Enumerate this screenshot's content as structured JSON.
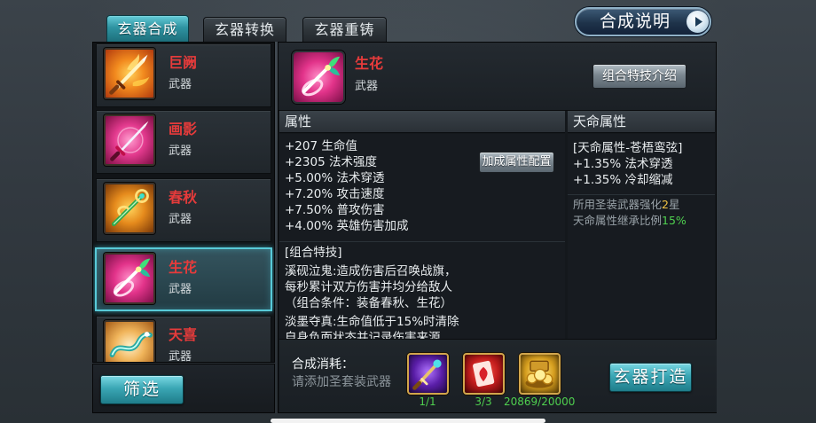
{
  "tabs": [
    {
      "label": "玄器合成",
      "active": true
    },
    {
      "label": "玄器转换",
      "active": false
    },
    {
      "label": "玄器重铸",
      "active": false
    }
  ],
  "help_button": {
    "label": "合成说明",
    "icon": "arrow-right-icon"
  },
  "item_list": [
    {
      "name": "巨阙",
      "type": "武器",
      "icon": "golden-flame-sword-icon",
      "selected": false
    },
    {
      "name": "画影",
      "type": "武器",
      "icon": "pink-sword-icon",
      "selected": false
    },
    {
      "name": "春秋",
      "type": "武器",
      "icon": "jade-staff-icon",
      "selected": false
    },
    {
      "name": "生花",
      "type": "武器",
      "icon": "flower-wand-icon",
      "selected": true
    },
    {
      "name": "天喜",
      "type": "武器",
      "icon": "jade-dragon-icon",
      "selected": false
    }
  ],
  "filter_button": {
    "label": "筛选"
  },
  "detail": {
    "name": "生花",
    "type": "武器",
    "icon": "flower-wand-icon",
    "combo_intro_button": "组合特技介绍",
    "attributes_header": "属性",
    "bonus_config_button": "加成属性配置",
    "attributes": [
      "+207 生命值",
      "+2305 法术强度",
      "+5.00% 法术穿透",
      "+7.20% 攻击速度",
      "+7.50% 普攻伤害",
      "+4.00% 英雄伤害加成"
    ],
    "combo_title": "[组合特技]",
    "combo_lines": [
      "溪砚泣鬼:造成伤害后召唤战旗，",
      "每秒累计双方伤害并均分给敌人",
      "（组合条件：装备春秋、生花）",
      "淡墨夺真:生命值低于15%时清除",
      "自身负面状态并记录伤害来源"
    ],
    "destiny_header": "天命属性",
    "destiny_title": "[天命属性-苍梧鸾弦]",
    "destiny_attributes": [
      "+1.35% 法术穿透",
      "+1.35% 冷却缩减"
    ],
    "enhance_note": {
      "text": "所用圣装武器强化",
      "value": "2",
      "unit": "星"
    },
    "inherit_note": {
      "text": "天命属性继承比例",
      "value": "15%"
    }
  },
  "cost": {
    "label": "合成消耗：",
    "hint": "请添加圣套装武器",
    "items": [
      {
        "icon": "purple-staff-icon",
        "count": "1/1"
      },
      {
        "icon": "red-card-icon",
        "count": "3/3"
      },
      {
        "icon": "gold-treasure-icon",
        "count": "20869/20000"
      }
    ],
    "forge_button": "玄器打造"
  },
  "colors": {
    "accent_teal": "#36a9b7",
    "item_name_red": "#e63b3b",
    "highlight_yellow": "#f2c445",
    "value_green": "#4fd04f",
    "muted_gray": "#9aa3a9"
  }
}
